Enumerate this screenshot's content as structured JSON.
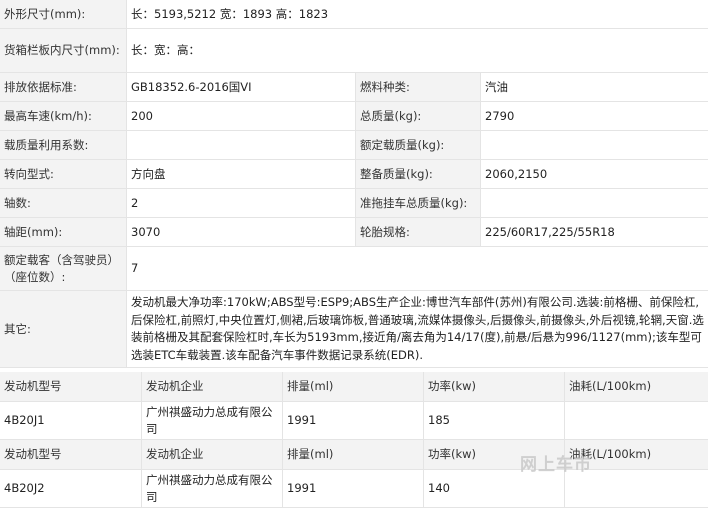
{
  "specs": {
    "dims_label": "外形尺寸(mm):",
    "dims_value": "长：5193,5212 宽：1893 高：1823",
    "cargo_label": "货箱栏板内尺寸(mm):",
    "cargo_value": "长：宽：高：",
    "emission_label": "排放依据标准:",
    "emission_value": "GB18352.6-2016国VI",
    "fuel_label": "燃料种类:",
    "fuel_value": "汽油",
    "speed_label": "最高车速(km/h):",
    "speed_value": "200",
    "total_mass_label": "总质量(kg):",
    "total_mass_value": "2790",
    "util_label": "载质量利用系数:",
    "util_value": "",
    "rated_load_label": "额定载质量(kg):",
    "rated_load_value": "",
    "steering_label": "转向型式:",
    "steering_value": "方向盘",
    "curb_label": "整备质量(kg):",
    "curb_value": "2060,2150",
    "axles_label": "轴数:",
    "axles_value": "2",
    "trailer_label": "准拖挂车总质量(kg):",
    "trailer_value": "",
    "wheelbase_label": "轴距(mm):",
    "wheelbase_value": "3070",
    "tire_label": "轮胎规格:",
    "tire_value": "225/60R17,225/55R18",
    "seats_label": "额定载客（含驾驶员）（座位数）:",
    "seats_value": "7",
    "other_label": "其它:",
    "other_value": "发动机最大净功率:170kW;ABS型号:ESP9;ABS生产企业:博世汽车部件(苏州)有限公司.选装:前格栅、前保险杠,后保险杠,前照灯,中央位置灯,侧裙,后玻璃饰板,普通玻璃,流媒体摄像头,后摄像头,前摄像头,外后视镜,轮辋,天窗.选装前格栅及其配套保险杠时,车长为5193mm,接近角/离去角为14/17(度),前悬/后悬为996/1127(mm);该车型可选装ETC车载装置.该车配备汽车事件数据记录系统(EDR)."
  },
  "engines": {
    "headers": [
      "发动机型号",
      "发动机企业",
      "排量(ml)",
      "功率(kw)",
      "油耗(L/100km)"
    ],
    "rows": [
      {
        "model": "4B20J1",
        "maker": "广州祺盛动力总成有限公司",
        "displacement": "1991",
        "power": "185",
        "fuel": ""
      },
      {
        "model": "4B20J2",
        "maker": "广州祺盛动力总成有限公司",
        "displacement": "1991",
        "power": "140",
        "fuel": ""
      }
    ]
  },
  "watermark": "网上车市"
}
